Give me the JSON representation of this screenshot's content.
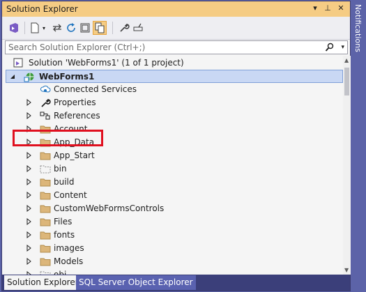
{
  "window": {
    "title": "Solution Explorer"
  },
  "notifications_label": "Notifications",
  "search": {
    "placeholder": "Search Solution Explorer (Ctrl+;)"
  },
  "toolbar": {
    "icons": [
      "vs-switch-views-icon",
      "new-file-icon",
      "sync-icon",
      "refresh-icon",
      "collapse-all-icon",
      "show-all-files-icon",
      "properties-wrench-icon",
      "preview-icon"
    ]
  },
  "tree": {
    "solution": "Solution 'WebForms1' (1 of 1 project)",
    "project": "WebForms1",
    "items": [
      {
        "label": "Connected Services",
        "icon": "connected-services-icon",
        "expandable": false
      },
      {
        "label": "Properties",
        "icon": "wrench-icon",
        "expandable": true
      },
      {
        "label": "References",
        "icon": "references-icon",
        "expandable": true
      },
      {
        "label": "Account",
        "icon": "folder-icon",
        "expandable": true
      },
      {
        "label": "App_Data",
        "icon": "folder-icon",
        "expandable": true
      },
      {
        "label": "App_Start",
        "icon": "folder-icon",
        "expandable": true
      },
      {
        "label": "bin",
        "icon": "folder-dashed-icon",
        "expandable": true
      },
      {
        "label": "build",
        "icon": "folder-icon",
        "expandable": true
      },
      {
        "label": "Content",
        "icon": "folder-icon",
        "expandable": true
      },
      {
        "label": "CustomWebFormsControls",
        "icon": "folder-icon",
        "expandable": true
      },
      {
        "label": "Files",
        "icon": "folder-icon",
        "expandable": true
      },
      {
        "label": "fonts",
        "icon": "folder-icon",
        "expandable": true
      },
      {
        "label": "images",
        "icon": "folder-icon",
        "expandable": true
      },
      {
        "label": "Models",
        "icon": "folder-icon",
        "expandable": true
      },
      {
        "label": "obj",
        "icon": "folder-dashed-icon",
        "expandable": true
      }
    ]
  },
  "tabs": [
    {
      "label": "Solution Explorer",
      "active": true
    },
    {
      "label": "SQL Server Object Explorer",
      "active": false
    }
  ],
  "colors": {
    "title_accent": "#f5cc84",
    "selection": "#c9d8f4",
    "highlight_box": "#e0101f",
    "folder": "#dcb67a",
    "tab_bar": "#3b3f7a"
  }
}
